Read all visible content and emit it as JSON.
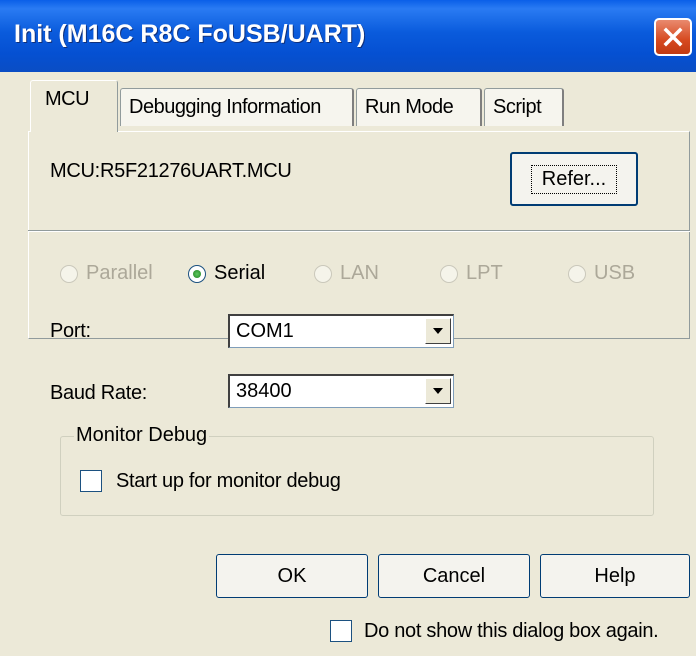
{
  "window": {
    "title": "Init (M16C R8C FoUSB/UART)"
  },
  "tabs": [
    {
      "label": "MCU",
      "active": true
    },
    {
      "label": "Debugging Information",
      "active": false
    },
    {
      "label": "Run Mode",
      "active": false
    },
    {
      "label": "Script",
      "active": false
    }
  ],
  "mcu": {
    "label": "MCU:",
    "value": "R5F21276UART.MCU",
    "refer_button": "Refer..."
  },
  "connection": {
    "options": [
      {
        "label": "Parallel",
        "checked": false,
        "enabled": false
      },
      {
        "label": "Serial",
        "checked": true,
        "enabled": true
      },
      {
        "label": "LAN",
        "checked": false,
        "enabled": false
      },
      {
        "label": "LPT",
        "checked": false,
        "enabled": false
      },
      {
        "label": "USB",
        "checked": false,
        "enabled": false
      }
    ]
  },
  "port": {
    "label": "Port:",
    "value": "COM1"
  },
  "baud_rate": {
    "label": "Baud Rate:",
    "value": "38400"
  },
  "monitor_debug": {
    "title": "Monitor Debug",
    "checkbox_label": "Start up for monitor debug",
    "checked": false
  },
  "buttons": {
    "ok": "OK",
    "cancel": "Cancel",
    "help": "Help"
  },
  "footer": {
    "do_not_show_label": "Do not show this dialog box again.",
    "checked": false
  },
  "colors": {
    "title_bar": "#0a5bdc",
    "dialog_bg": "#ece9d8",
    "close_button": "#d6491f",
    "radio_selected": "#21a121"
  }
}
